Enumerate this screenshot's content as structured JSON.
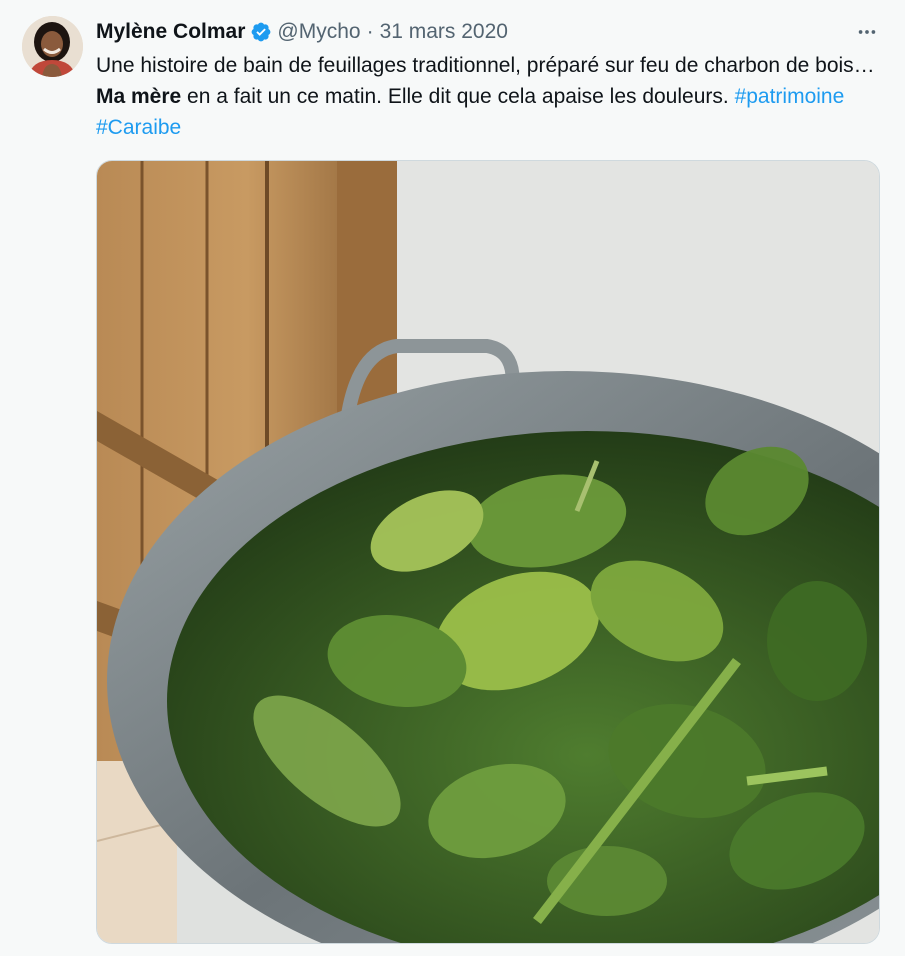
{
  "author": {
    "name": "Mylène Colmar",
    "handle": "@Mycho",
    "date": "31 mars 2020",
    "verified": true
  },
  "tweet": {
    "text_part1": "Une histoire de bain de feuillages traditionnel, préparé sur feu de charbon de bois… ",
    "text_bold": "Ma mère",
    "text_part2": " en a fait un ce matin. Elle dit que cela apaise les douleurs. ",
    "hashtags": [
      "#patrimoine",
      "#Caraibe"
    ]
  },
  "icons": {
    "verified": "verified-badge-icon",
    "more": "more-options-icon"
  },
  "colors": {
    "accent": "#1d9bf0",
    "text": "#0f1419",
    "muted": "#536471"
  }
}
